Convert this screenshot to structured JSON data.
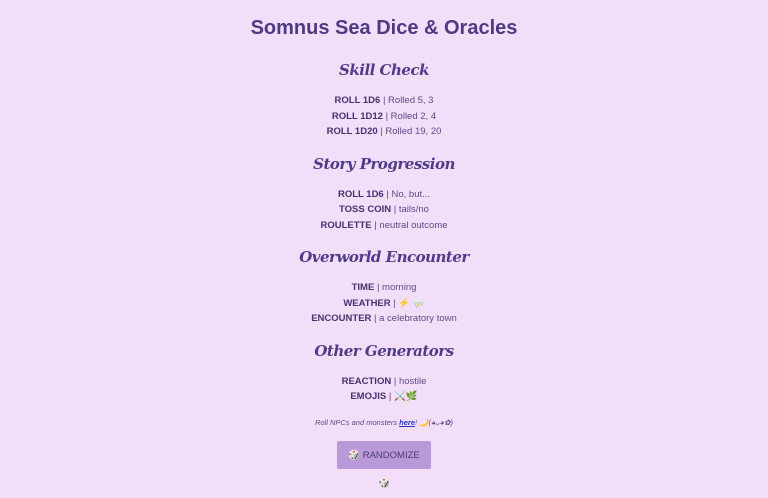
{
  "title": "Somnus Sea Dice & Oracles",
  "sections": [
    {
      "title": "Skill Check",
      "rows": [
        {
          "label": "ROLL 1D6",
          "value": "| Rolled 5, 3"
        },
        {
          "label": "ROLL 1D12",
          "value": "| Rolled 2, 4"
        },
        {
          "label": "ROLL 1D20",
          "value": "| Rolled 19, 20"
        }
      ]
    },
    {
      "title": "Story Progression",
      "rows": [
        {
          "label": "ROLL 1D6",
          "value": "| No, but..."
        },
        {
          "label": "TOSS COIN",
          "value": "| tails/no"
        },
        {
          "label": "ROULETTE",
          "value": "| neutral outcome"
        }
      ]
    },
    {
      "title": "Overworld Encounter",
      "rows": [
        {
          "label": "TIME",
          "value": "| morning"
        },
        {
          "label": "WEATHER",
          "value": "| ⚡ ⛈️"
        },
        {
          "label": "ENCOUNTER",
          "value": "| a celebratory town"
        }
      ]
    },
    {
      "title": "Other Generators",
      "rows": [
        {
          "label": "REACTION",
          "value": "| hostile"
        },
        {
          "label": "EMOJIS",
          "value": "| ⚔️🌿"
        }
      ]
    }
  ],
  "note": {
    "prefix": "Roll NPCs and monsters ",
    "link": "here",
    "suffix": "! 🌙(◕ᴗ◕✿)"
  },
  "button": {
    "label": "🎲 RANDOMIZE 🎲"
  }
}
